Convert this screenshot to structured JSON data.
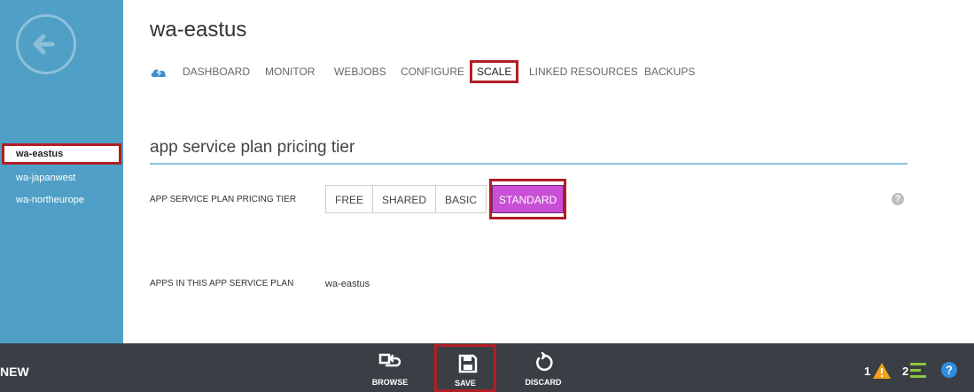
{
  "sidebar": {
    "items": [
      {
        "label": "wa-eastus",
        "selected": true
      },
      {
        "label": "wa-japanwest",
        "selected": false
      },
      {
        "label": "wa-northeurope",
        "selected": false
      }
    ]
  },
  "header": {
    "title": "wa-eastus",
    "tabs": [
      {
        "label": "DASHBOARD"
      },
      {
        "label": "MONITOR"
      },
      {
        "label": "WEBJOBS"
      },
      {
        "label": "CONFIGURE"
      },
      {
        "label": "SCALE",
        "active": true
      },
      {
        "label": "LINKED RESOURCES"
      },
      {
        "label": "BACKUPS"
      }
    ]
  },
  "section": {
    "title": "app service plan pricing tier",
    "tier_label": "APP SERVICE PLAN PRICING TIER",
    "tiers": [
      "FREE",
      "SHARED",
      "BASIC",
      "STANDARD"
    ],
    "selected_tier": "STANDARD",
    "apps_label": "APPS IN THIS APP SERVICE PLAN",
    "apps_value": "wa-eastus"
  },
  "bottombar": {
    "new_label": "NEW",
    "commands": [
      {
        "label": "BROWSE"
      },
      {
        "label": "SAVE"
      },
      {
        "label": "DISCARD"
      }
    ],
    "status": {
      "warnings": "1",
      "notifications": "2"
    }
  },
  "colors": {
    "sidebar": "#4f9fc6",
    "highlight": "#b11e24",
    "selected_tier": "#c94fd6",
    "bottombar": "#3a3f45",
    "warning": "#f3a21c",
    "notification": "#8cc63f",
    "help": "#2f8ee0"
  },
  "icons": [
    "back-arrow-icon",
    "cloud-lightning-icon",
    "help-icon",
    "browse-icon",
    "save-icon",
    "discard-icon",
    "warning-icon",
    "notification-icon",
    "help-circle-icon"
  ]
}
